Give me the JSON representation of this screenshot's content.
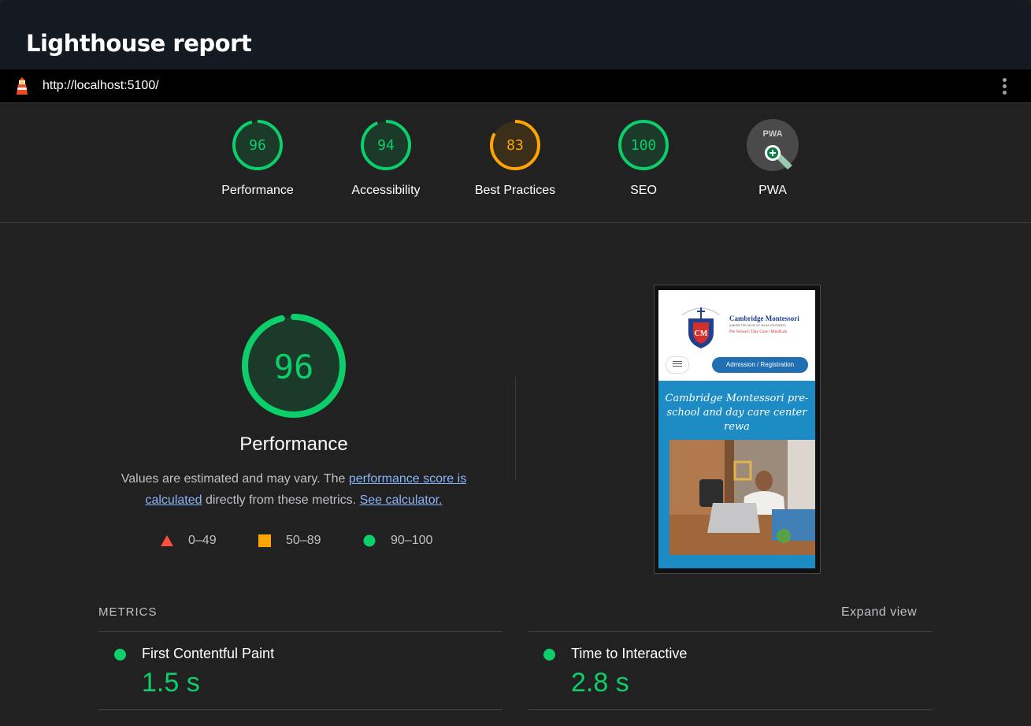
{
  "window": {
    "title": "Lighthouse report"
  },
  "urlbar": {
    "url": "http://localhost:5100/"
  },
  "colors": {
    "pass": "#0cce6b",
    "average": "#ffa400",
    "fail": "#ff4e42",
    "link": "#8ab4f8"
  },
  "categories": [
    {
      "label": "Performance",
      "score": 96,
      "status": "pass"
    },
    {
      "label": "Accessibility",
      "score": 94,
      "status": "pass"
    },
    {
      "label": "Best Practices",
      "score": 83,
      "status": "average"
    },
    {
      "label": "SEO",
      "score": 100,
      "status": "pass"
    },
    {
      "label": "PWA",
      "badge": "PWA",
      "icon": "pwa-badge-icon"
    }
  ],
  "performance": {
    "score": 96,
    "title": "Performance",
    "desc_part1": "Values are estimated and may vary. The ",
    "desc_link1": "performance score is calculated",
    "desc_part2": " directly from these metrics. ",
    "desc_link2": "See calculator."
  },
  "legend": [
    {
      "label": "0–49",
      "shape": "triangle"
    },
    {
      "label": "50–89",
      "shape": "square"
    },
    {
      "label": "90–100",
      "shape": "circle"
    }
  ],
  "screenshot": {
    "brand_name": "Cambridge Montessori",
    "brand_sub": "(UNDER THE AEGIS OF JALSA VENTURES)",
    "brand_tagline": "Pre School | Day Care | MindLab",
    "cta": "Admission / Registration",
    "hero_text": "Cambridge Montessori pre-school and day care center rewa"
  },
  "metrics": {
    "heading": "METRICS",
    "expand_label": "Expand view",
    "items": [
      {
        "label": "First Contentful Paint",
        "value": "1.5 s",
        "status": "pass"
      },
      {
        "label": "Time to Interactive",
        "value": "2.8 s",
        "status": "pass"
      }
    ]
  }
}
